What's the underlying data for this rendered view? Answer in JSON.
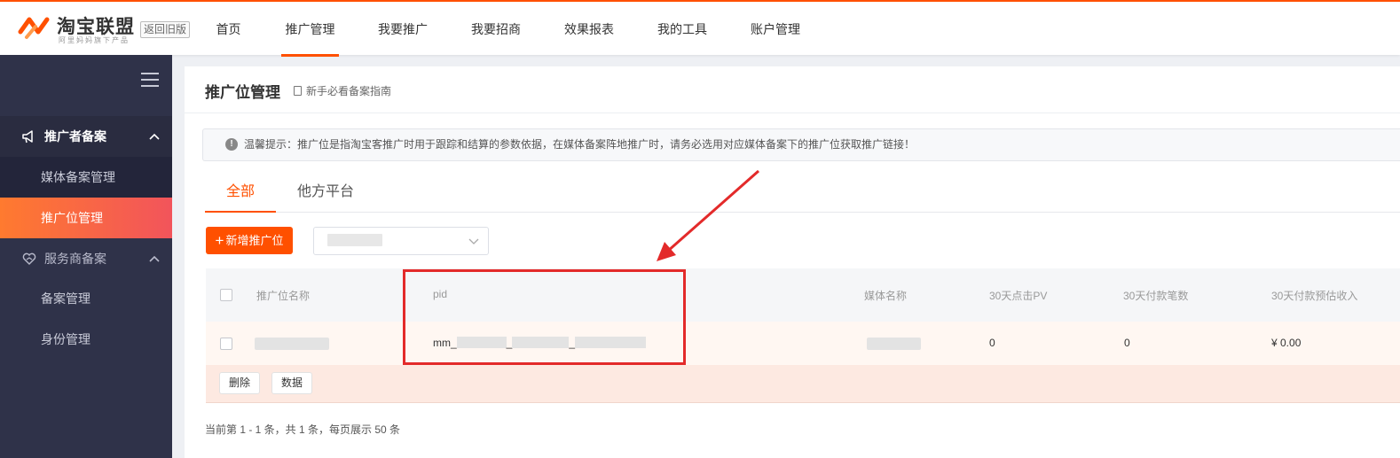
{
  "app": {
    "logo_text": "淘宝联盟",
    "logo_sub": "阿里妈妈旗下产品",
    "old_version_label": "返回旧版"
  },
  "nav": {
    "items": [
      {
        "label": "首页",
        "active": false
      },
      {
        "label": "推广管理",
        "active": true
      },
      {
        "label": "我要推广",
        "active": false
      },
      {
        "label": "我要招商",
        "active": false
      },
      {
        "label": "效果报表",
        "active": false
      },
      {
        "label": "我的工具",
        "active": false
      },
      {
        "label": "账户管理",
        "active": false
      }
    ]
  },
  "sidebar": {
    "group1": {
      "label": "推广者备案",
      "icon": "megaphone-icon",
      "expanded": true
    },
    "group1_items": [
      {
        "label": "媒体备案管理",
        "active": false
      },
      {
        "label": "推广位管理",
        "active": true
      }
    ],
    "group2": {
      "label": "服务商备案",
      "icon": "handshake-icon",
      "expanded": true
    },
    "group2_items": [
      {
        "label": "备案管理",
        "active": false
      },
      {
        "label": "身份管理",
        "active": false
      }
    ]
  },
  "page": {
    "title": "推广位管理",
    "guide_link": "新手必看备案指南",
    "tip": "温馨提示：推广位是指淘宝客推广时用于跟踪和结算的参数依据，在媒体备案阵地推广时，请务必选用对应媒体备案下的推广位获取推广链接！",
    "tabs": [
      {
        "label": "全部",
        "active": true
      },
      {
        "label": "他方平台",
        "active": false
      }
    ],
    "new_button": "新增推广位",
    "new_button_icon": "plus-icon"
  },
  "table": {
    "columns": [
      "推广位名称",
      "pid",
      "媒体名称",
      "30天点击PV",
      "30天付款笔数",
      "30天付款预估收入"
    ],
    "rows": [
      {
        "name": "",
        "pid_prefix": "mm_",
        "pid_sep1": "_",
        "pid_sep2": "_",
        "media": "",
        "pv": "0",
        "orders": "0",
        "income": "¥ 0.00"
      }
    ],
    "row_actions": [
      "删除",
      "数据"
    ]
  },
  "pager": {
    "text": "当前第 1 - 1 条，共 1 条，每页展示 50 条"
  },
  "colors": {
    "brand": "#ff5000",
    "sidebar_bg": "#2f3249",
    "annotation_red": "#e32a2a"
  }
}
